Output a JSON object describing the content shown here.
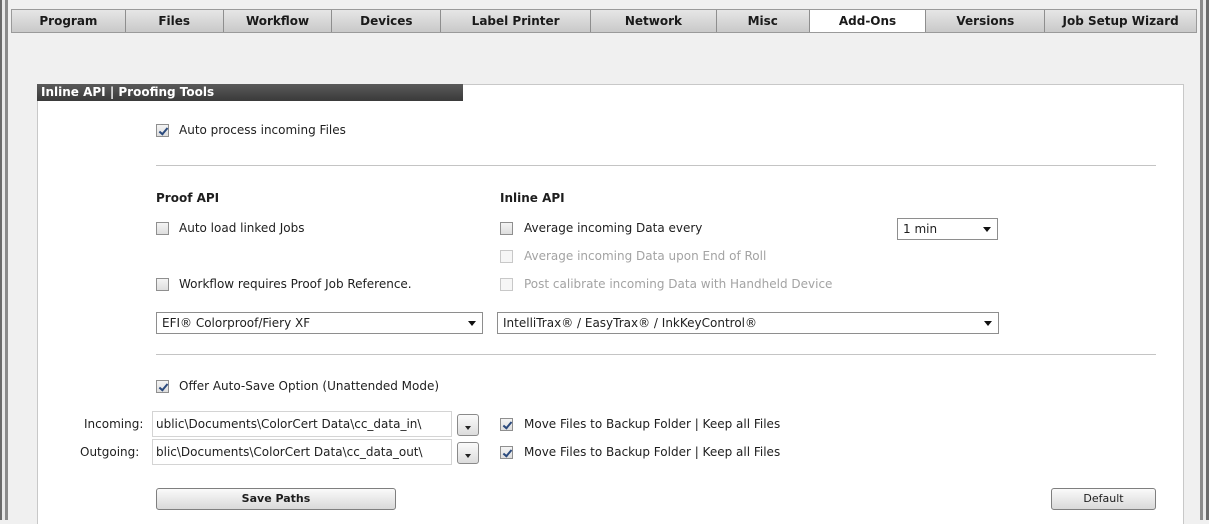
{
  "tabs": [
    {
      "label": "Program"
    },
    {
      "label": "Files"
    },
    {
      "label": "Workflow"
    },
    {
      "label": "Devices"
    },
    {
      "label": "Label Printer"
    },
    {
      "label": "Network"
    },
    {
      "label": "Misc"
    },
    {
      "label": "Add-Ons",
      "active": true
    },
    {
      "label": "Versions"
    },
    {
      "label": "Job Setup Wizard"
    }
  ],
  "section": {
    "title": "Inline API | Proofing Tools"
  },
  "auto_process": {
    "label": "Auto process incoming Files",
    "checked": true
  },
  "proof_api": {
    "heading": "Proof API",
    "auto_load": {
      "label": "Auto load linked Jobs",
      "checked": false
    },
    "requires_ref": {
      "label": "Workflow requires Proof Job Reference.",
      "checked": false
    },
    "select": "EFI® Colorproof/Fiery XF"
  },
  "inline_api": {
    "heading": "Inline API",
    "average_every": {
      "label": "Average incoming Data every",
      "checked": false
    },
    "interval": "1 min",
    "average_roll": {
      "label": "Average incoming Data upon End of Roll",
      "checked": false,
      "disabled": true
    },
    "post_calibrate": {
      "label": "Post calibrate incoming Data with Handheld Device",
      "checked": false,
      "disabled": true
    },
    "select": "IntelliTrax® / EasyTrax® / InkKeyControl®"
  },
  "autosave": {
    "label": "Offer Auto-Save Option (Unattended Mode)",
    "checked": true
  },
  "incoming": {
    "label": "Incoming:",
    "path": "ublic\\Documents\\ColorCert Data\\cc_data_in\\",
    "move_label": "Move Files to Backup Folder | Keep all Files",
    "move_checked": true
  },
  "outgoing": {
    "label": "Outgoing:",
    "path": "blic\\Documents\\ColorCert Data\\cc_data_out\\",
    "move_label": "Move Files to Backup Folder | Keep all Files",
    "move_checked": true
  },
  "buttons": {
    "save_paths": "Save Paths",
    "default": "Default"
  }
}
